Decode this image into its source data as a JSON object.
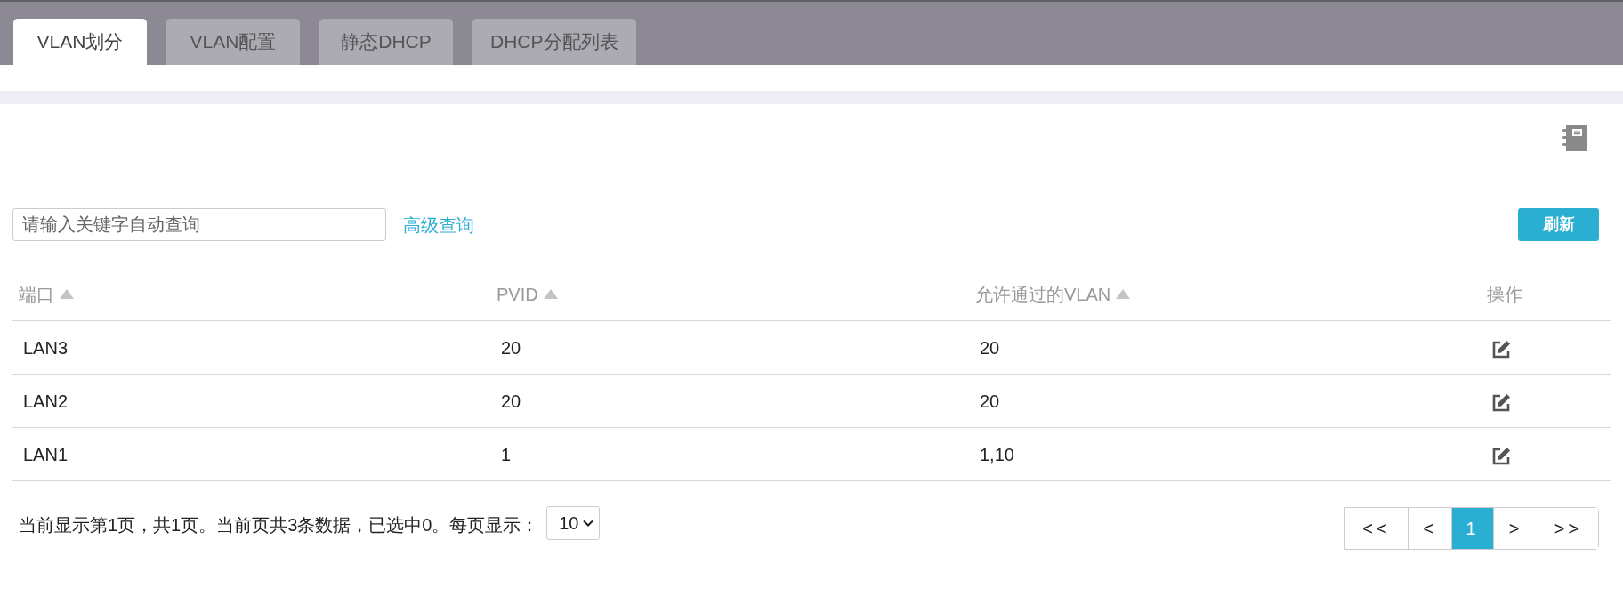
{
  "tabs": [
    {
      "label": "VLAN划分",
      "selected": true
    },
    {
      "label": "VLAN配置",
      "selected": false
    },
    {
      "label": "静态DHCP",
      "selected": false
    },
    {
      "label": "DHCP分配列表",
      "selected": false
    }
  ],
  "toolbar": {
    "search": {
      "placeholder": "请输入关键字自动查询"
    },
    "advanced_link": "高级查询",
    "refresh_button": "刷新"
  },
  "table": {
    "columns": [
      {
        "label": "端口",
        "sortable": true
      },
      {
        "label": "PVID",
        "sortable": true
      },
      {
        "label": "允许通过的VLAN",
        "sortable": true
      },
      {
        "label": "操作",
        "sortable": false
      }
    ],
    "rows": [
      {
        "port": "LAN3",
        "pvid": "20",
        "allowed_vlan": "20"
      },
      {
        "port": "LAN2",
        "pvid": "20",
        "allowed_vlan": "20"
      },
      {
        "port": "LAN1",
        "pvid": "1",
        "allowed_vlan": "1,10"
      }
    ]
  },
  "pagination": {
    "summary": "当前显示第1页，共1页。当前页共3条数据，已选中0。每页显示：",
    "page_size": "10",
    "buttons": [
      {
        "label": "<<",
        "selected": false
      },
      {
        "label": "<",
        "selected": false
      },
      {
        "label": "1",
        "selected": true
      },
      {
        "label": ">",
        "selected": false
      },
      {
        "label": ">>",
        "selected": false
      }
    ]
  }
}
